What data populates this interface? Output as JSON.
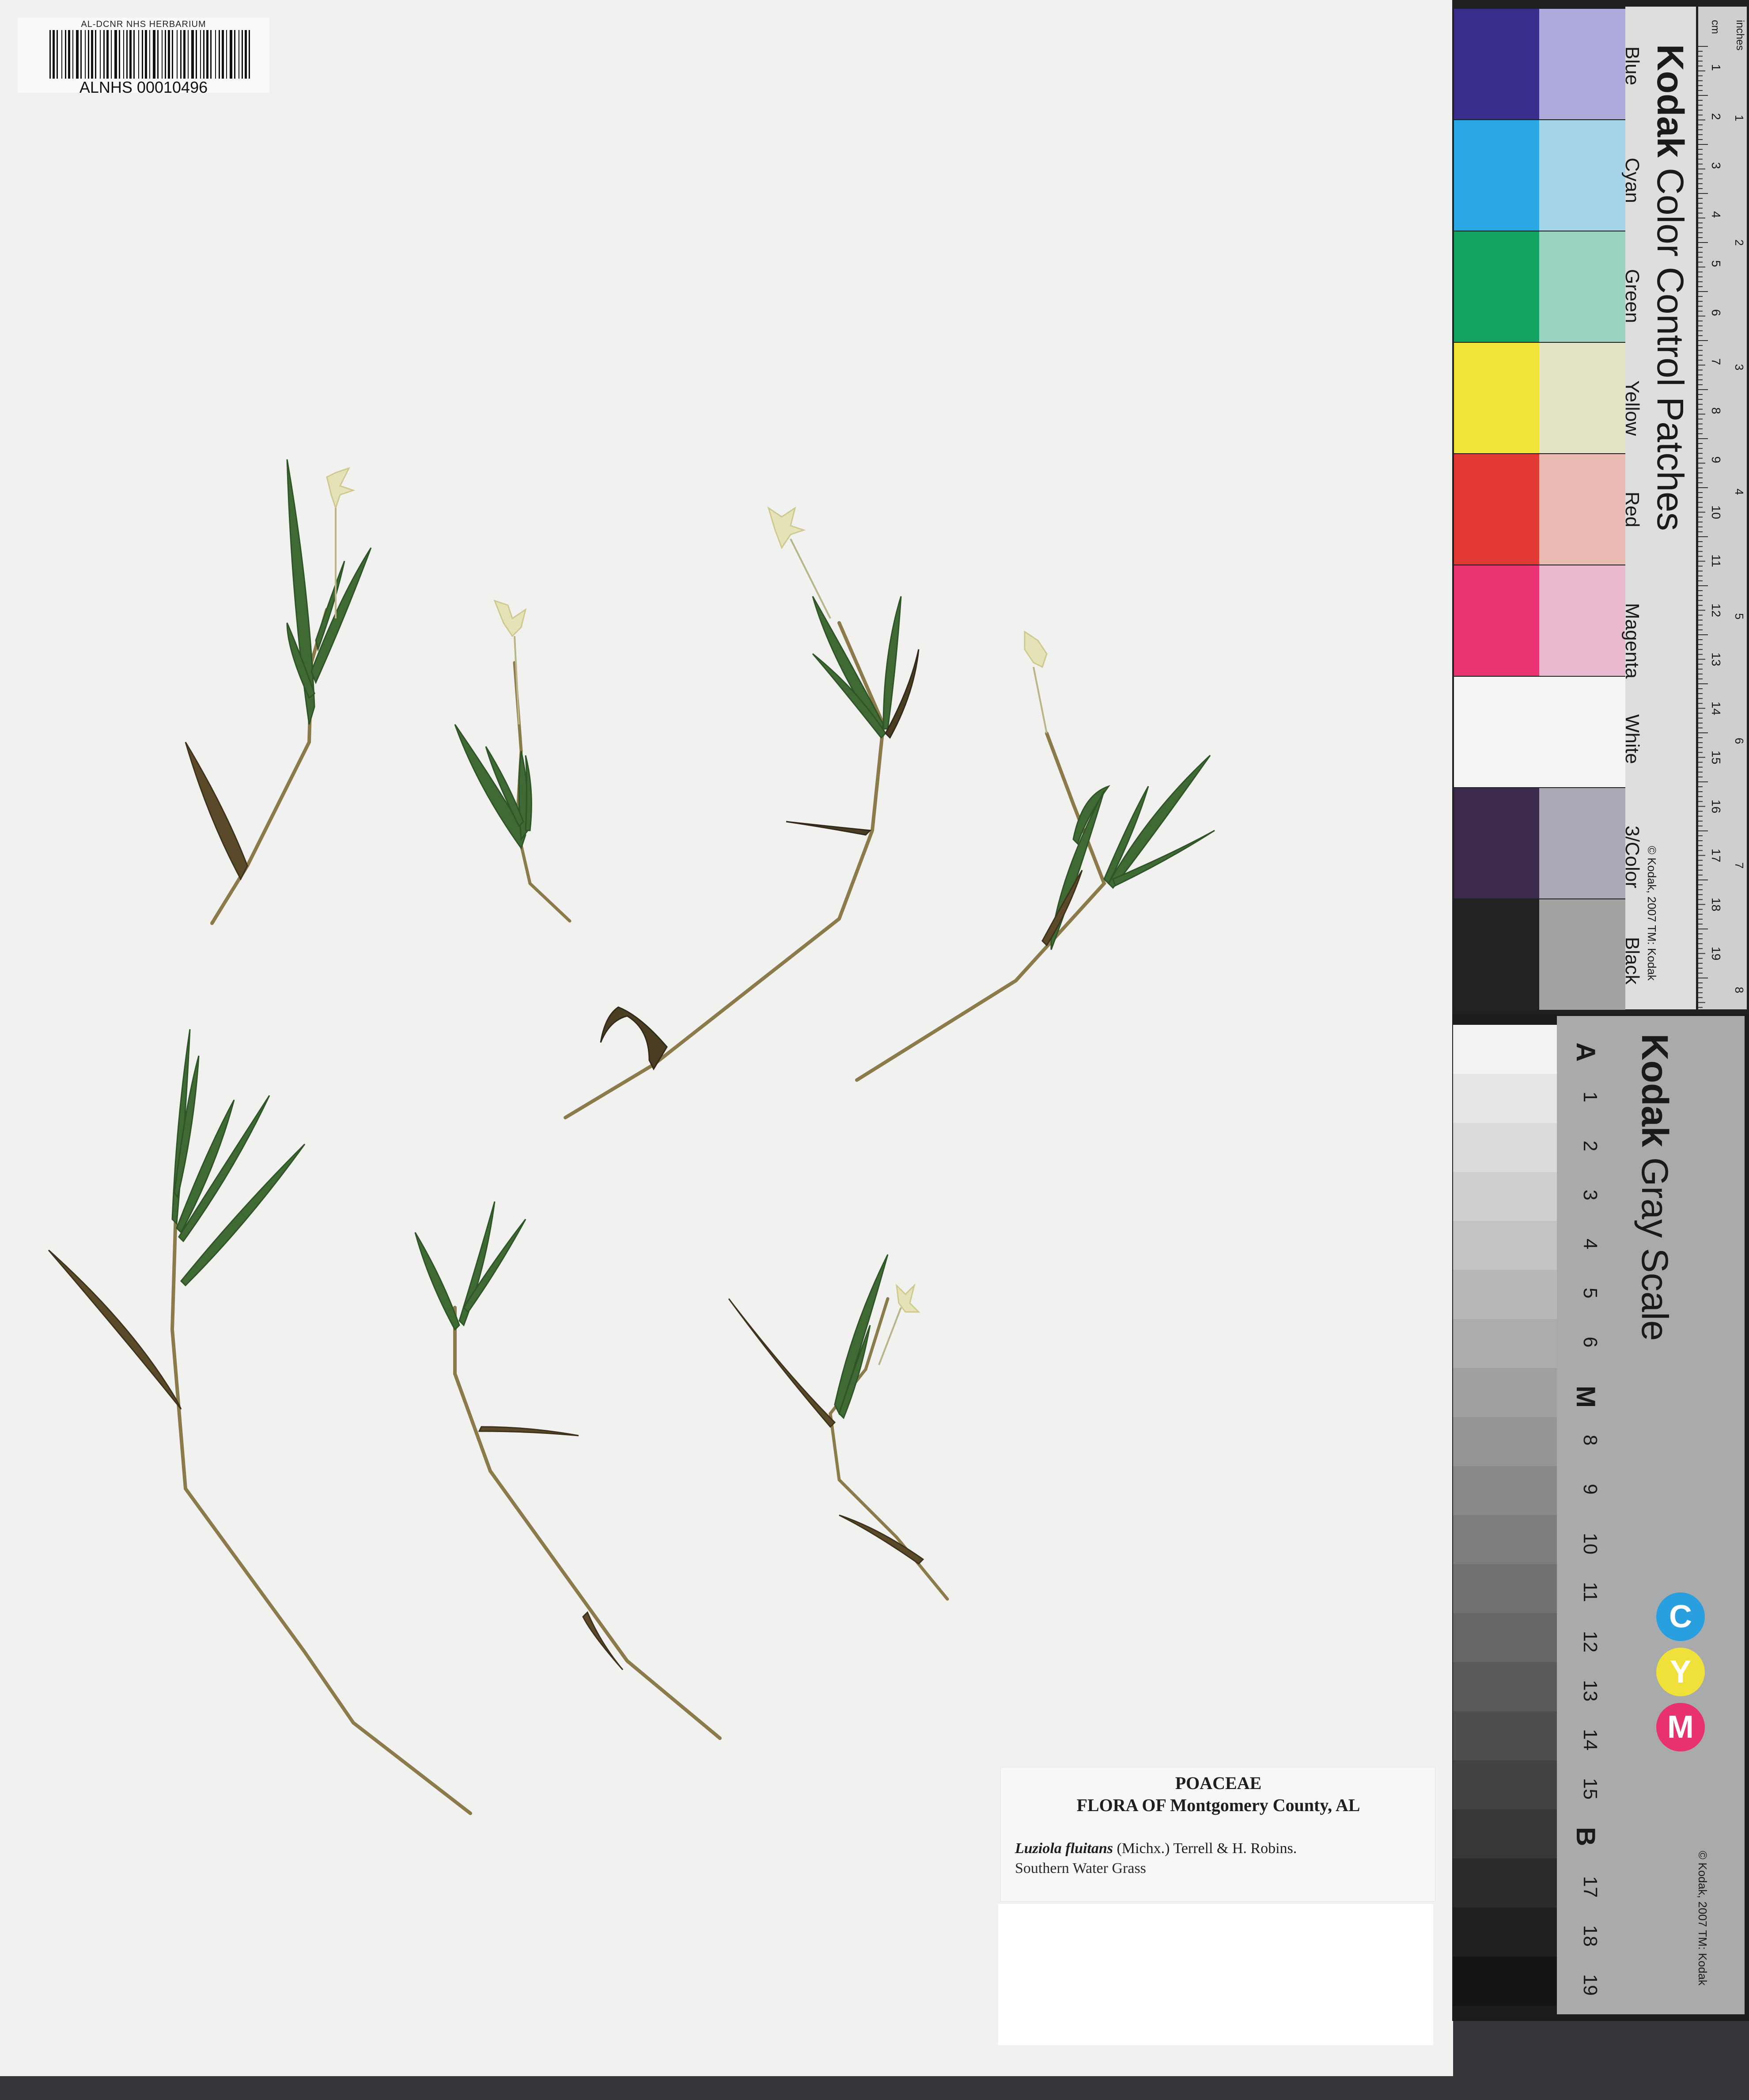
{
  "barcode": {
    "header": "AL-DCNR NHS HERBARIUM",
    "number": "ALNHS 00010496"
  },
  "label": {
    "family": "POACEAE",
    "flora": "FLORA OF Montgomery County, AL",
    "scientific_name": "Luziola fluitans",
    "authority": " (Michx.) Terrell & H. Robins.",
    "common_name": "Southern Water Grass"
  },
  "color_card": {
    "brand": "Kodak",
    "title": " Color Control Patches",
    "copyright": "© Kodak, 2007 TM: Kodak",
    "ruler_cm_label": "cm",
    "ruler_in_label": "inches",
    "patches": [
      {
        "name": "Blue",
        "dark": "#3a2e8c",
        "light": "#aeaadc"
      },
      {
        "name": "Cyan",
        "dark": "#2aa8e6",
        "light": "#a6d4ea"
      },
      {
        "name": "Green",
        "dark": "#13a463",
        "light": "#98d3bf"
      },
      {
        "name": "Yellow",
        "dark": "#f0e33a",
        "light": "#e3e4c6"
      },
      {
        "name": "Red",
        "dark": "#e23a32",
        "light": "#e9bbb2"
      },
      {
        "name": "Magenta",
        "dark": "#ea3373",
        "light": "#e9bad0"
      },
      {
        "name": "White",
        "dark": "#f4f4f2",
        "light": "#f4f4f2"
      },
      {
        "name": "3/Color",
        "dark": "#3b2a4b",
        "light": "#a9a8b4"
      },
      {
        "name": "Black",
        "dark": "#222224",
        "light": "#a2a2a2"
      }
    ],
    "ruler_cm": [
      "1",
      "2",
      "3",
      "4",
      "5",
      "6",
      "7",
      "8",
      "9",
      "10",
      "11",
      "12",
      "13",
      "14",
      "15",
      "16",
      "17",
      "18",
      "19"
    ],
    "ruler_in": [
      "1",
      "2",
      "3",
      "4",
      "5",
      "6",
      "7",
      "8"
    ]
  },
  "gray_card": {
    "brand": "Kodak",
    "title": " Gray Scale",
    "copyright": "© Kodak, 2007 TM: Kodak",
    "steps": [
      "A",
      "1",
      "2",
      "3",
      "4",
      "5",
      "6",
      "M",
      "8",
      "9",
      "10",
      "11",
      "12",
      "13",
      "14",
      "15",
      "B",
      "17",
      "18",
      "19"
    ],
    "dots": [
      {
        "letter": "C",
        "color": "#2a9fe0"
      },
      {
        "letter": "Y",
        "color": "#efe03a"
      },
      {
        "letter": "M",
        "color": "#e8326d"
      }
    ]
  }
}
